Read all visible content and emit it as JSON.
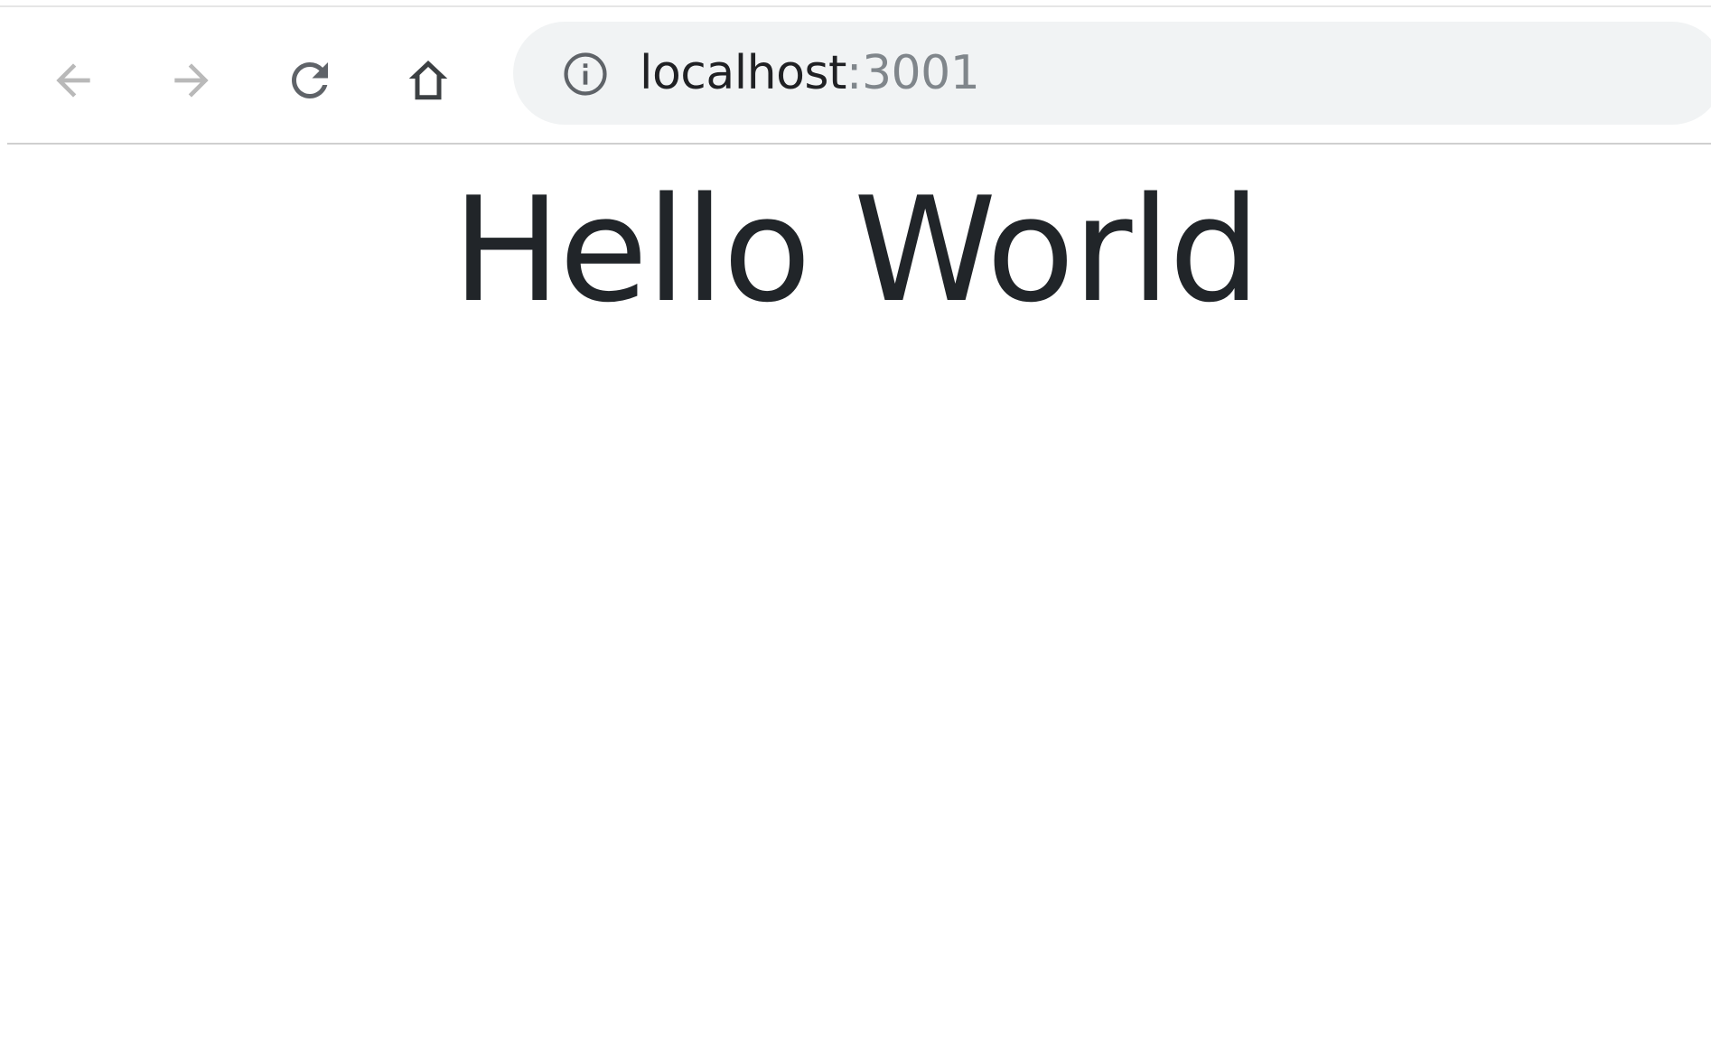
{
  "browser": {
    "toolbar": {
      "back_icon": "arrow-left-icon",
      "forward_icon": "arrow-right-icon",
      "reload_icon": "reload-icon",
      "home_icon": "home-icon"
    },
    "address_bar": {
      "security_icon": "info-circle-icon",
      "url_host": "localhost",
      "url_port": ":3001"
    }
  },
  "page": {
    "heading": "Hello World"
  },
  "colors": {
    "heading_text": "#212529",
    "omnibox_bg": "#f1f3f4",
    "nav_disabled": "#b9b9b9",
    "nav_active": "#5f6368",
    "url_port": "#80868b"
  }
}
